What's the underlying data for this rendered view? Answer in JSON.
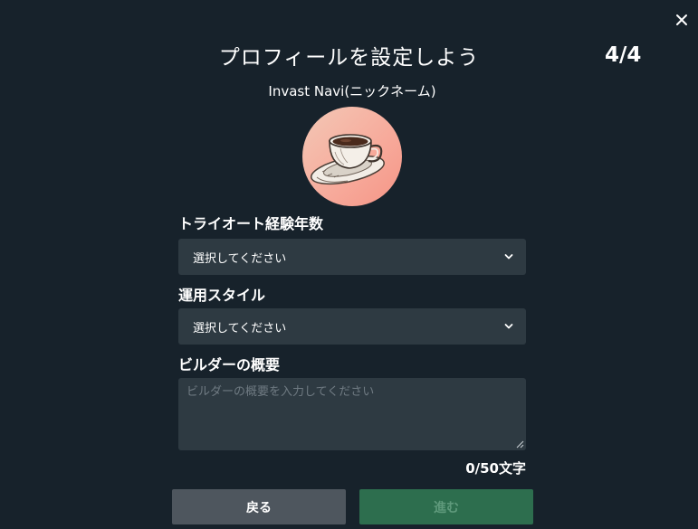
{
  "dialog": {
    "title": "プロフィールを設定しよう",
    "step": "4/4",
    "nickname": "Invast Navi(ニックネーム)"
  },
  "avatar": {
    "icon": "coffee-cup-illustration",
    "bg_color": "#f7a99a"
  },
  "fields": {
    "trial_years": {
      "label": "トライオート経験年数",
      "value": "選択してください"
    },
    "style": {
      "label": "運用スタイル",
      "value": "選択してください"
    },
    "summary": {
      "label": "ビルダーの概要",
      "placeholder": "ビルダーの概要を入力してください",
      "value": "",
      "counter": "0/50文字"
    }
  },
  "buttons": {
    "back": "戻る",
    "next": "進む"
  },
  "colors": {
    "background": "#17222b",
    "input_bg": "#2e3a42",
    "back_button": "#4e565e",
    "next_button": "#2d6e4e"
  }
}
